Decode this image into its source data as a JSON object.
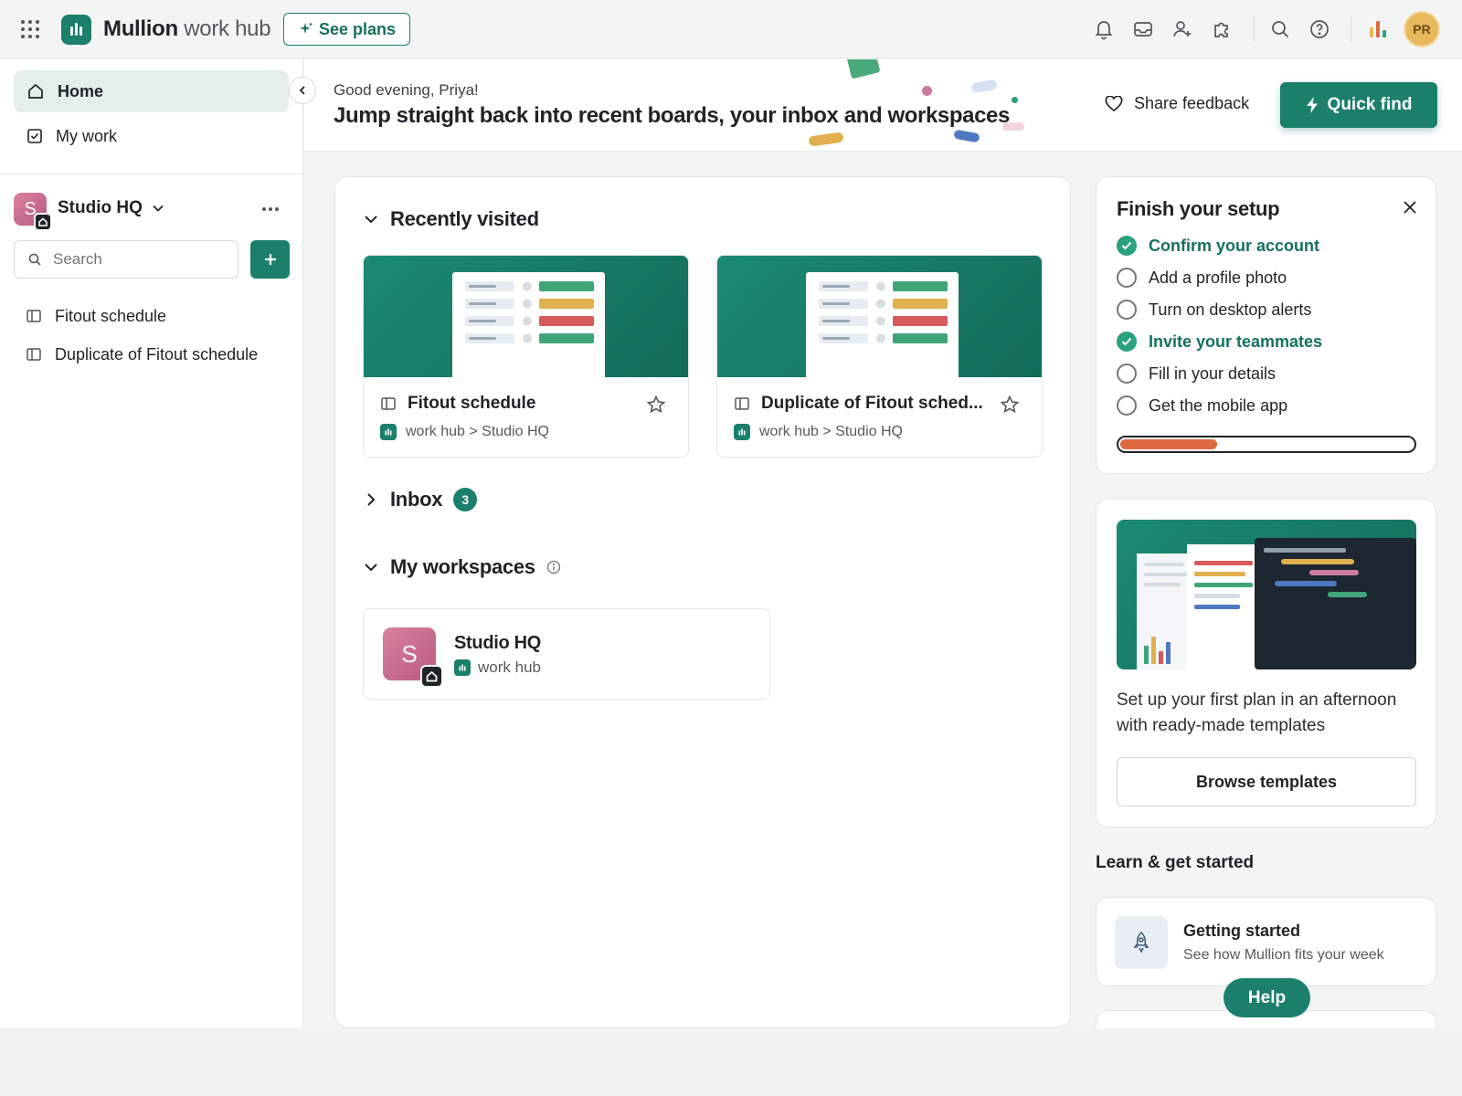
{
  "app": {
    "brand_bold": "Mullion",
    "brand_rest": " work hub",
    "see_plans_label": "See plans",
    "avatar_initials": "PR"
  },
  "topbar_icons": [
    "bell-icon",
    "inbox-icon",
    "invite-user-icon",
    "extensions-icon",
    "search-icon",
    "help-icon",
    "chart-icon"
  ],
  "sidebar": {
    "nav": [
      {
        "label": "Home",
        "icon": "home-icon",
        "active": true
      },
      {
        "label": "My work",
        "icon": "my-work-icon",
        "active": false
      }
    ],
    "workspace": {
      "initial": "S",
      "name": "Studio HQ"
    },
    "search_placeholder": "Search",
    "boards": [
      {
        "label": "Fitout schedule"
      },
      {
        "label": "Duplicate of Fitout schedule"
      }
    ]
  },
  "hero": {
    "greeting": "Good evening, Priya!",
    "headline": "Jump straight back into recent boards, your inbox and workspaces",
    "share_feedback": "Share feedback",
    "quick_find": "Quick find"
  },
  "recently_visited": {
    "title": "Recently visited",
    "cards": [
      {
        "title": "Fitout schedule",
        "path": "work hub > Studio HQ"
      },
      {
        "title": "Duplicate of Fitout sched...",
        "path": "work hub > Studio HQ"
      }
    ]
  },
  "inbox": {
    "title": "Inbox",
    "count": "3"
  },
  "workspaces": {
    "title": "My workspaces",
    "items": [
      {
        "initial": "S",
        "name": "Studio HQ",
        "subtitle": "work hub"
      }
    ]
  },
  "setup": {
    "title": "Finish your setup",
    "items": [
      {
        "label": "Confirm your account",
        "done": true
      },
      {
        "label": "Add a profile photo",
        "done": false
      },
      {
        "label": "Turn on desktop alerts",
        "done": false
      },
      {
        "label": "Invite your teammates",
        "done": true
      },
      {
        "label": "Fill in your details",
        "done": false
      },
      {
        "label": "Get the mobile app",
        "done": false
      }
    ],
    "progress_fraction": 0.33
  },
  "templates_promo": {
    "text": "Set up your first plan in an afternoon with ready-made templates",
    "button": "Browse templates"
  },
  "learn": {
    "title": "Learn & get started",
    "cards": [
      {
        "title": "Getting started",
        "subtitle": "See how Mullion fits your week"
      }
    ]
  },
  "help_label": "Help",
  "colors": {
    "accent": "#1b7f6c",
    "done_green": "#2aa17f",
    "progress": "#e06a3f",
    "workspace_pink": "#c96e90",
    "avatar_gold": "#e8b85c"
  }
}
